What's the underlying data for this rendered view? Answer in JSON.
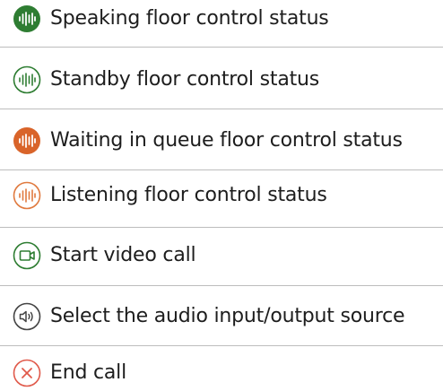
{
  "colors": {
    "speaking": "#2e7d32",
    "standby": "#2e7d32",
    "waiting": "#d9642a",
    "listening": "#e07a3f",
    "video": "#2e7d32",
    "audio": "#444444",
    "end": "#e05a4b",
    "text": "#1d1d1d",
    "divider": "#bdbdbd"
  },
  "items": [
    {
      "icon": "speaking-floor-icon",
      "label": "Speaking floor control status"
    },
    {
      "icon": "standby-floor-icon",
      "label": "Standby floor control status"
    },
    {
      "icon": "waiting-queue-floor-icon",
      "label": "Waiting in queue floor control status"
    },
    {
      "icon": "listening-floor-icon",
      "label": "Listening floor control status"
    },
    {
      "icon": "video-call-icon",
      "label": "Start video call"
    },
    {
      "icon": "audio-source-icon",
      "label": "Select the audio input/output source"
    },
    {
      "icon": "end-call-icon",
      "label": "End call"
    }
  ]
}
